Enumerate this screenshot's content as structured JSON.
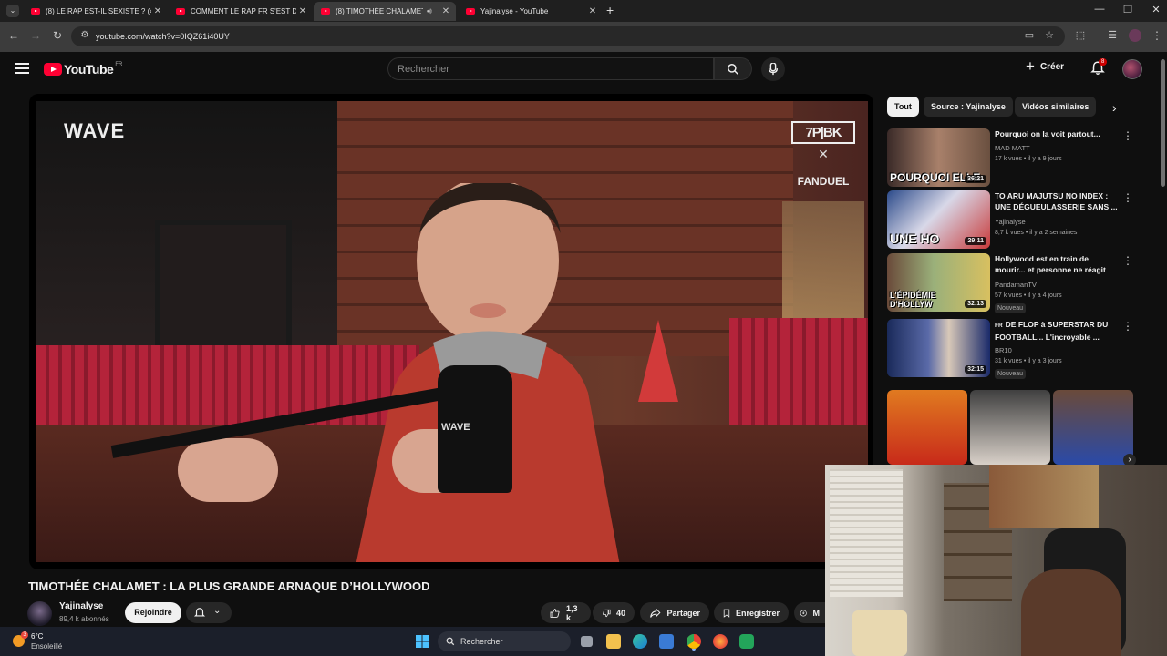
{
  "browser": {
    "tabs": [
      {
        "label": "(8) LE RAP EST-IL SEXISTE ? (4 F",
        "active": false
      },
      {
        "label": "COMMENT LE RAP FR S'EST DÉ",
        "active": false
      },
      {
        "label": "(8) TIMOTHÉE CHALAMET",
        "active": true
      },
      {
        "label": "Yajinalyse - YouTube",
        "active": false
      }
    ],
    "new_tab": "+",
    "url": "youtube.com/watch?v=0IQZ61i40UY"
  },
  "youtube": {
    "logo_text": "YouTube",
    "country_code": "FR",
    "search_placeholder": "Rechercher",
    "create_label": "Créer",
    "notifications_count": "8"
  },
  "video": {
    "overlay_brand": "WAVE",
    "sponsor_box": "7P|BK",
    "sponsor_x": "✕",
    "sponsor_name": "FANDUEL",
    "mic_label": "WAVE",
    "title": "TIMOTHÉE CHALAMET : LA PLUS GRANDE ARNAQUE D’HOLLYWOOD",
    "channel": "Yajinalyse",
    "subscribers": "89,4 k abonnés",
    "join_label": "Rejoindre",
    "likes": "1,3 k",
    "dislikes": "40",
    "share_label": "Partager",
    "save_label": "Enregistrer",
    "more_label": "M"
  },
  "sidebar": {
    "chips": [
      "Tout",
      "Source : Yajinalyse",
      "Vidéos similaires"
    ],
    "recommendations": [
      {
        "title": "Pourquoi on la voit partout...",
        "channel": "MAD MATT",
        "meta": "17 k vues • il y a 9 jours",
        "duration": "36:21",
        "thumb_text": "POURQUOI ELLE",
        "badge": ""
      },
      {
        "title": "TO ARU MAJUTSU NO INDEX : UNE DÉGUEULASSERIE SANS ...",
        "channel": "Yajinalyse",
        "meta": "8,7 k vues • il y a 2 semaines",
        "duration": "29:11",
        "thumb_text": "UNE HO",
        "badge": ""
      },
      {
        "title": "Hollywood est en train de mourir... et personne ne réagit",
        "channel": "PandamanTV",
        "meta": "57 k vues • il y a 4 jours",
        "duration": "32:13",
        "thumb_text": "L'ÉPIDÉMIE D'HOLLYW",
        "badge": "Nouveau"
      },
      {
        "title": "DE FLOP à SUPERSTAR DU FOOTBALL... L'incroyable ...",
        "channel": "BR10",
        "meta": "31 k vues • il y a 3 jours",
        "duration": "32:15",
        "thumb_text": "",
        "badge": "Nouveau",
        "prefix": "FR"
      }
    ]
  },
  "taskbar": {
    "weather_badge": "3",
    "temperature": "6°C",
    "condition": "Ensoleillé",
    "search_label": "Rechercher"
  }
}
